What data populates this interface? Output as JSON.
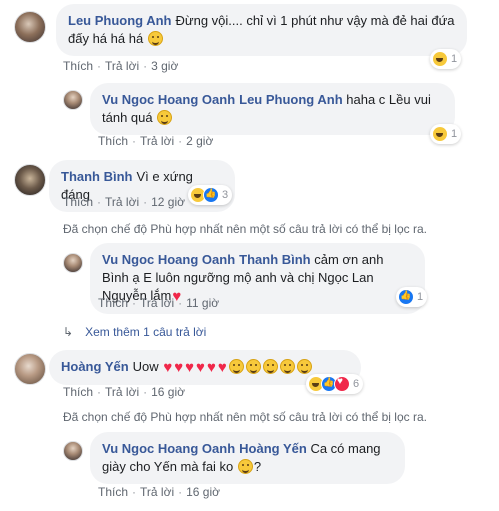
{
  "comments": [
    {
      "author": "Leu Phuong Anh",
      "text": "Đừng vội.... chỉ vì 1 phút như vậy mà đẻ hai đứa đấy há há há",
      "like": "Thích",
      "reply": "Trả lời",
      "time": "3 giờ",
      "reaction_count": "1"
    },
    {
      "author": "Vu Ngoc Hoang Oanh",
      "mention": "Leu Phuong Anh",
      "text": "haha c Lều vui tánh quá",
      "like": "Thích",
      "reply": "Trả lời",
      "time": "2 giờ",
      "reaction_count": "1"
    },
    {
      "author": "Thanh Bình",
      "text": "Vì e xứng đáng",
      "like": "Thích",
      "reply": "Trả lời",
      "time": "12 giờ",
      "reaction_count": "3"
    },
    {
      "author": "Vu Ngoc Hoang Oanh",
      "mention": "Thanh Bình",
      "text": "cảm ơn anh Bình ạ E luôn ngưỡng mộ anh và chị Ngọc Lan Nguyễn lắm",
      "like": "Thích",
      "reply": "Trả lời",
      "time": "11 giờ",
      "reaction_count": "1"
    },
    {
      "author": "Hoàng Yến",
      "text": "Uow",
      "like": "Thích",
      "reply": "Trả lời",
      "time": "16 giờ",
      "reaction_count": "6"
    },
    {
      "author": "Vu Ngoc Hoang Oanh",
      "mention": "Hoàng Yến",
      "text": "Ca có mang giày cho Yến mà fai ko",
      "like": "Thích",
      "reply": "Trả lời",
      "time": "16 giờ"
    }
  ],
  "filter_notice": "Đã chọn chế độ Phù hợp nhất nên một số câu trả lời có thể bị lọc ra.",
  "see_more": "Xem thêm 1 câu trả lời",
  "colors": {
    "link": "#385898",
    "bubble": "#f2f3f5",
    "meta": "#606770"
  }
}
